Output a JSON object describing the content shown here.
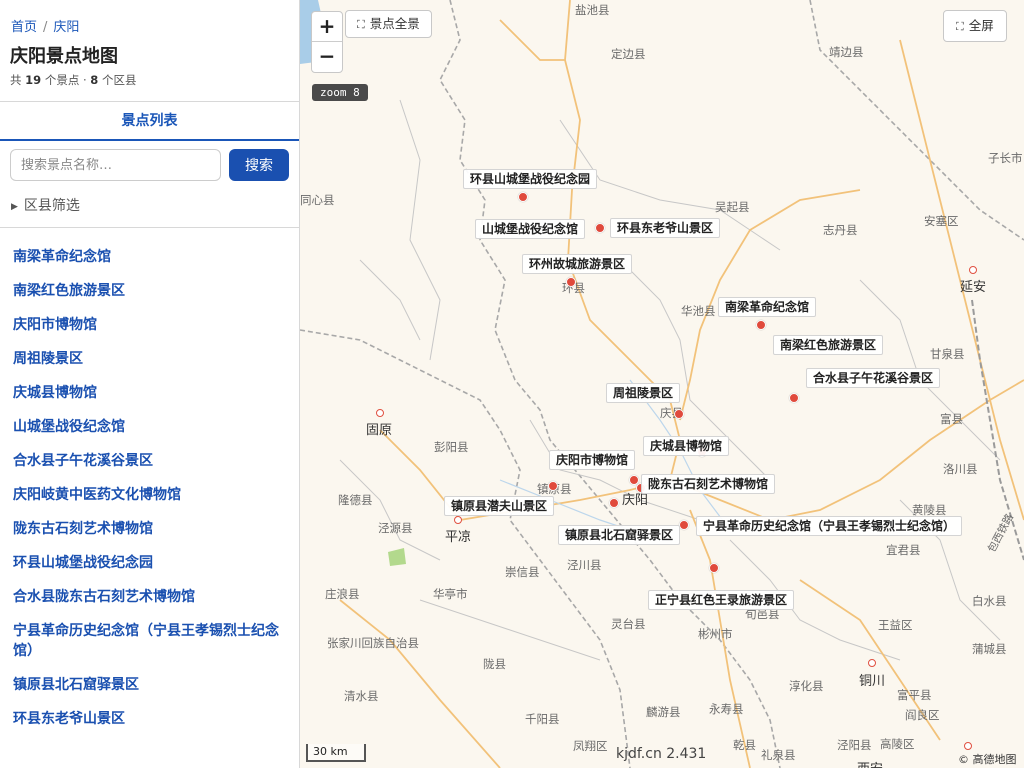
{
  "breadcrumb": {
    "home": "首页",
    "separator": "/",
    "current": "庆阳"
  },
  "page_title": "庆阳景点地图",
  "stats": {
    "prefix": "共",
    "spots": "19",
    "spots_unit": "个景点",
    "dot": "·",
    "districts": "8",
    "districts_unit": "个区县"
  },
  "tab_label": "景点列表",
  "search": {
    "placeholder": "搜索景点名称…",
    "value": "",
    "button": "搜索"
  },
  "filter_label": "区县筛选",
  "spot_list": [
    "南梁革命纪念馆",
    "南梁红色旅游景区",
    "庆阳市博物馆",
    "周祖陵景区",
    "庆城县博物馆",
    "山城堡战役纪念馆",
    "合水县子午花溪谷景区",
    "庆阳岐黄中医药文化博物馆",
    "陇东古石刻艺术博物馆",
    "环县山城堡战役纪念园",
    "合水县陇东古石刻艺术博物馆",
    "宁县革命历史纪念馆（宁县王孝锡烈士纪念馆）",
    "镇原县北石窟驿景区",
    "环县东老爷山景区"
  ],
  "map": {
    "zoom_in": "+",
    "zoom_out": "−",
    "overview_button": "景点全景",
    "fullscreen_button": "全屏",
    "expand_icon": "expand-icon",
    "zoom_badge": "zoom 8",
    "scale": "30 km",
    "watermark": "kjdf.cn 2.431",
    "attribution": "© 高德地图",
    "marker_color": "#e04a3c",
    "accent_color": "#1a50b0",
    "labels": {
      "huanxian_yuan": "环县山城堡战役纪念园",
      "shancheng": "山城堡战役纪念馆",
      "laoyeshan": "环县东老爷山景区",
      "huanzhou": "环州故城旅游景区",
      "nanliang_museum": "南梁革命纪念馆",
      "nanliang_red": "南梁红色旅游景区",
      "heshui_ziwu": "合水县子午花溪谷景区",
      "zhouzu": "周祖陵景区",
      "qingcheng_museum": "庆城县博物馆",
      "qingyang_museum": "庆阳市博物馆",
      "longdong": "陇东古石刻艺术博物馆",
      "qianfu": "镇原县潜夫山景区",
      "beishiku": "镇原县北石窟驿景区",
      "ningxian": "宁县革命历史纪念馆（宁县王孝锡烈士纪念馆）",
      "zhengning": "正宁县红色王录旅游景区"
    },
    "places": {
      "yanchi": "盐池县",
      "dingbian": "定边县",
      "jingbian": "靖边县",
      "zichang": "子长市",
      "tongxin": "同心县",
      "wuqi": "吴起县",
      "ansai": "安塞区",
      "zhidan": "志丹县",
      "yanan": "延安",
      "huan": "环县",
      "huachi": "华池县",
      "ganquan": "甘泉县",
      "guyuan": "固原",
      "qing": "庆县",
      "pengyang": "彭阳县",
      "fu": "富县",
      "luochuan": "洛川县",
      "qingyang": "庆阳",
      "zhenyuan": "镇原县",
      "longde": "隆德县",
      "jingyuan": "泾源县",
      "pingliang": "平凉",
      "huangling": "黄陵县",
      "yijun": "宜君县",
      "jingchuan": "泾川县",
      "chongxin": "崇信县",
      "huating": "华亭市",
      "zhuanglang": "庄浪县",
      "zhangjiachuan": "张家川回族自治县",
      "lingtai": "灵台县",
      "binzhou": "彬州市",
      "xunyi": "旬邑县",
      "baishui": "白水县",
      "yaozhou": "王益区",
      "long": "陇县",
      "qingshui": "清水县",
      "tongchuan": "铜川",
      "chunhua": "淳化县",
      "fuping": "富平县",
      "pucheng": "蒲城县",
      "qianyang": "千阳县",
      "linyou": "麟游县",
      "yongshou": "永寿县",
      "yanliang": "阎良区",
      "fengxiang": "凤翔区",
      "qian": "乾县",
      "liquan": "礼泉县",
      "jingyang": "泾阳县",
      "gaoling": "高陵区",
      "xian": "西安",
      "road": "包西铁路"
    }
  }
}
